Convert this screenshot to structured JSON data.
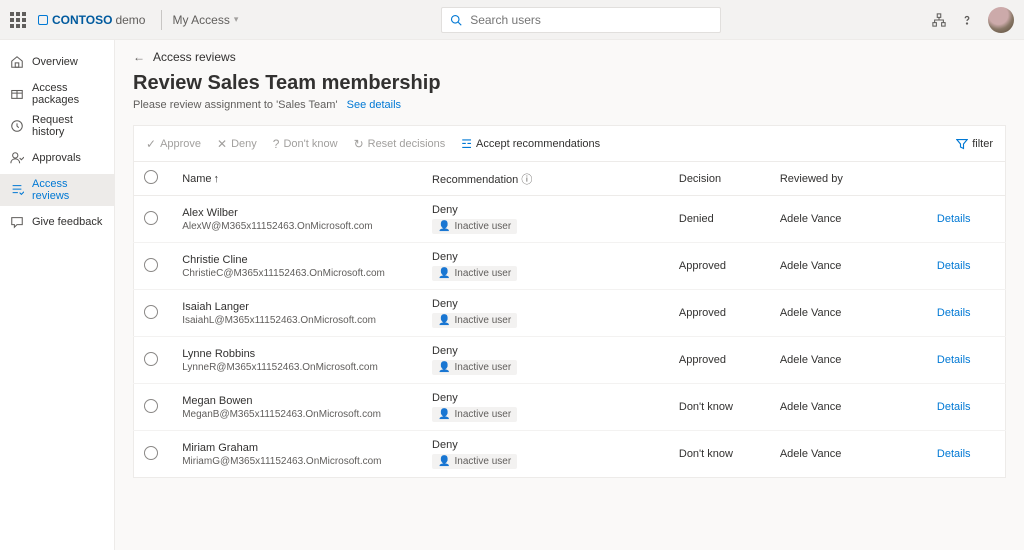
{
  "top": {
    "brand_strong": "CONTOSO",
    "brand_light": "demo",
    "dropdown": "My Access",
    "search_placeholder": "Search users"
  },
  "sidebar": {
    "items": [
      {
        "label": "Overview",
        "icon": "home"
      },
      {
        "label": "Access packages",
        "icon": "package"
      },
      {
        "label": "Request history",
        "icon": "history"
      },
      {
        "label": "Approvals",
        "icon": "approval"
      },
      {
        "label": "Access reviews",
        "icon": "review",
        "active": true
      },
      {
        "label": "Give feedback",
        "icon": "feedback"
      }
    ]
  },
  "page": {
    "back_label": "Access reviews",
    "title": "Review Sales Team membership",
    "subtitle": "Please review assignment to 'Sales Team'",
    "see_details": "See details"
  },
  "commands": {
    "approve": "Approve",
    "deny": "Deny",
    "dontknow": "Don't know",
    "reset": "Reset decisions",
    "accept": "Accept recommendations",
    "filter": "filter"
  },
  "table": {
    "headers": {
      "name": "Name",
      "recommendation": "Recommendation",
      "decision": "Decision",
      "reviewed": "Reviewed by"
    },
    "rows": [
      {
        "name": "Alex Wilber",
        "email": "AlexW@M365x11152463.OnMicrosoft.com",
        "rec": "Deny",
        "tag": "Inactive user",
        "decision": "Denied",
        "reviewer": "Adele Vance",
        "details": "Details"
      },
      {
        "name": "Christie Cline",
        "email": "ChristieC@M365x11152463.OnMicrosoft.com",
        "rec": "Deny",
        "tag": "Inactive user",
        "decision": "Approved",
        "reviewer": "Adele Vance",
        "details": "Details"
      },
      {
        "name": "Isaiah Langer",
        "email": "IsaiahL@M365x11152463.OnMicrosoft.com",
        "rec": "Deny",
        "tag": "Inactive user",
        "decision": "Approved",
        "reviewer": "Adele Vance",
        "details": "Details"
      },
      {
        "name": "Lynne Robbins",
        "email": "LynneR@M365x11152463.OnMicrosoft.com",
        "rec": "Deny",
        "tag": "Inactive user",
        "decision": "Approved",
        "reviewer": "Adele Vance",
        "details": "Details"
      },
      {
        "name": "Megan Bowen",
        "email": "MeganB@M365x11152463.OnMicrosoft.com",
        "rec": "Deny",
        "tag": "Inactive user",
        "decision": "Don't know",
        "reviewer": "Adele Vance",
        "details": "Details"
      },
      {
        "name": "Miriam Graham",
        "email": "MiriamG@M365x11152463.OnMicrosoft.com",
        "rec": "Deny",
        "tag": "Inactive user",
        "decision": "Don't know",
        "reviewer": "Adele Vance",
        "details": "Details"
      }
    ]
  }
}
